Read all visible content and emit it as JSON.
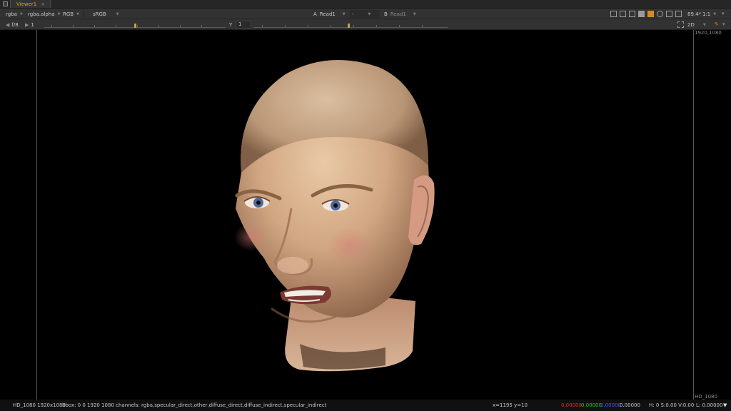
{
  "tabs": [
    {
      "label": "Viewer1",
      "close": "×"
    }
  ],
  "toolbar": {
    "layer_channels": "rgba",
    "display_channel": "rgba.alpha",
    "color_mode": "RGB",
    "lut": "sRGB",
    "input_a_letter": "A",
    "input_a": "Read1",
    "compare_mode": "-",
    "input_b_letter": "B",
    "input_b": "Read1",
    "zoom": "89.4*",
    "proxy": "1:1"
  },
  "toolbar2": {
    "fps_label": "f/8",
    "frame_value": "1",
    "y_label": "Y",
    "y_value": "1",
    "view_mode": "2D"
  },
  "viewer": {
    "format_top": "1920,1080",
    "format_bottom": "HD_1080"
  },
  "status": {
    "format": "HD_1080 1920x1080",
    "bbox": "bbox: 0 0 1920 1080 channels: rgba,specular_direct,other,diffuse_direct,diffuse_indirect,specular_indirect",
    "coords": "x=1195 y=10",
    "r": "0.00000",
    "g": "0.00000",
    "b": "0.00000",
    "a": "0.00000",
    "hsv": "H:  0 S:0.00 V:0.00",
    "luma": "L: 0.00000"
  },
  "colors": {
    "accent": "#e59a2a",
    "red": "#e0302b",
    "green": "#30c030",
    "blue": "#4a5ae8"
  }
}
